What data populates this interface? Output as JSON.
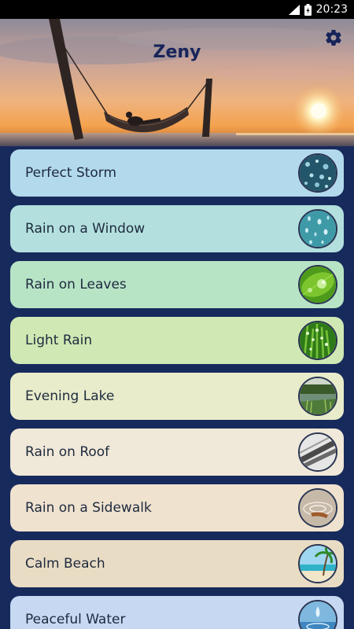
{
  "status_bar": {
    "time": "20:23",
    "icons": [
      "signal-icon",
      "battery-icon"
    ]
  },
  "app": {
    "title": "Zeny",
    "settings_icon": "gear-icon",
    "header_image": "sunset-hammock-photo"
  },
  "colors": {
    "background": "#172a5c",
    "title": "#17245a"
  },
  "sounds": [
    {
      "label": "Perfect Storm",
      "color": "#b3d9ec",
      "thumbnail": "storm-drops-thumb"
    },
    {
      "label": "Rain on a Window",
      "color": "#b3e0de",
      "thumbnail": "window-drops-thumb"
    },
    {
      "label": "Rain on Leaves",
      "color": "#b8e4c6",
      "thumbnail": "leaf-drop-thumb"
    },
    {
      "label": "Light Rain",
      "color": "#d0e9b4",
      "thumbnail": "grass-dew-thumb"
    },
    {
      "label": "Evening Lake",
      "color": "#e8ecca",
      "thumbnail": "lake-reeds-thumb"
    },
    {
      "label": "Rain on Roof",
      "color": "#f0e8d8",
      "thumbnail": "roof-thumb"
    },
    {
      "label": "Rain on a Sidewalk",
      "color": "#efe2cf",
      "thumbnail": "puddle-thumb"
    },
    {
      "label": "Calm Beach",
      "color": "#e9dcc4",
      "thumbnail": "beach-palm-thumb"
    },
    {
      "label": "Peaceful Water",
      "color": "#c6d8f2",
      "thumbnail": "water-drop-thumb"
    }
  ]
}
